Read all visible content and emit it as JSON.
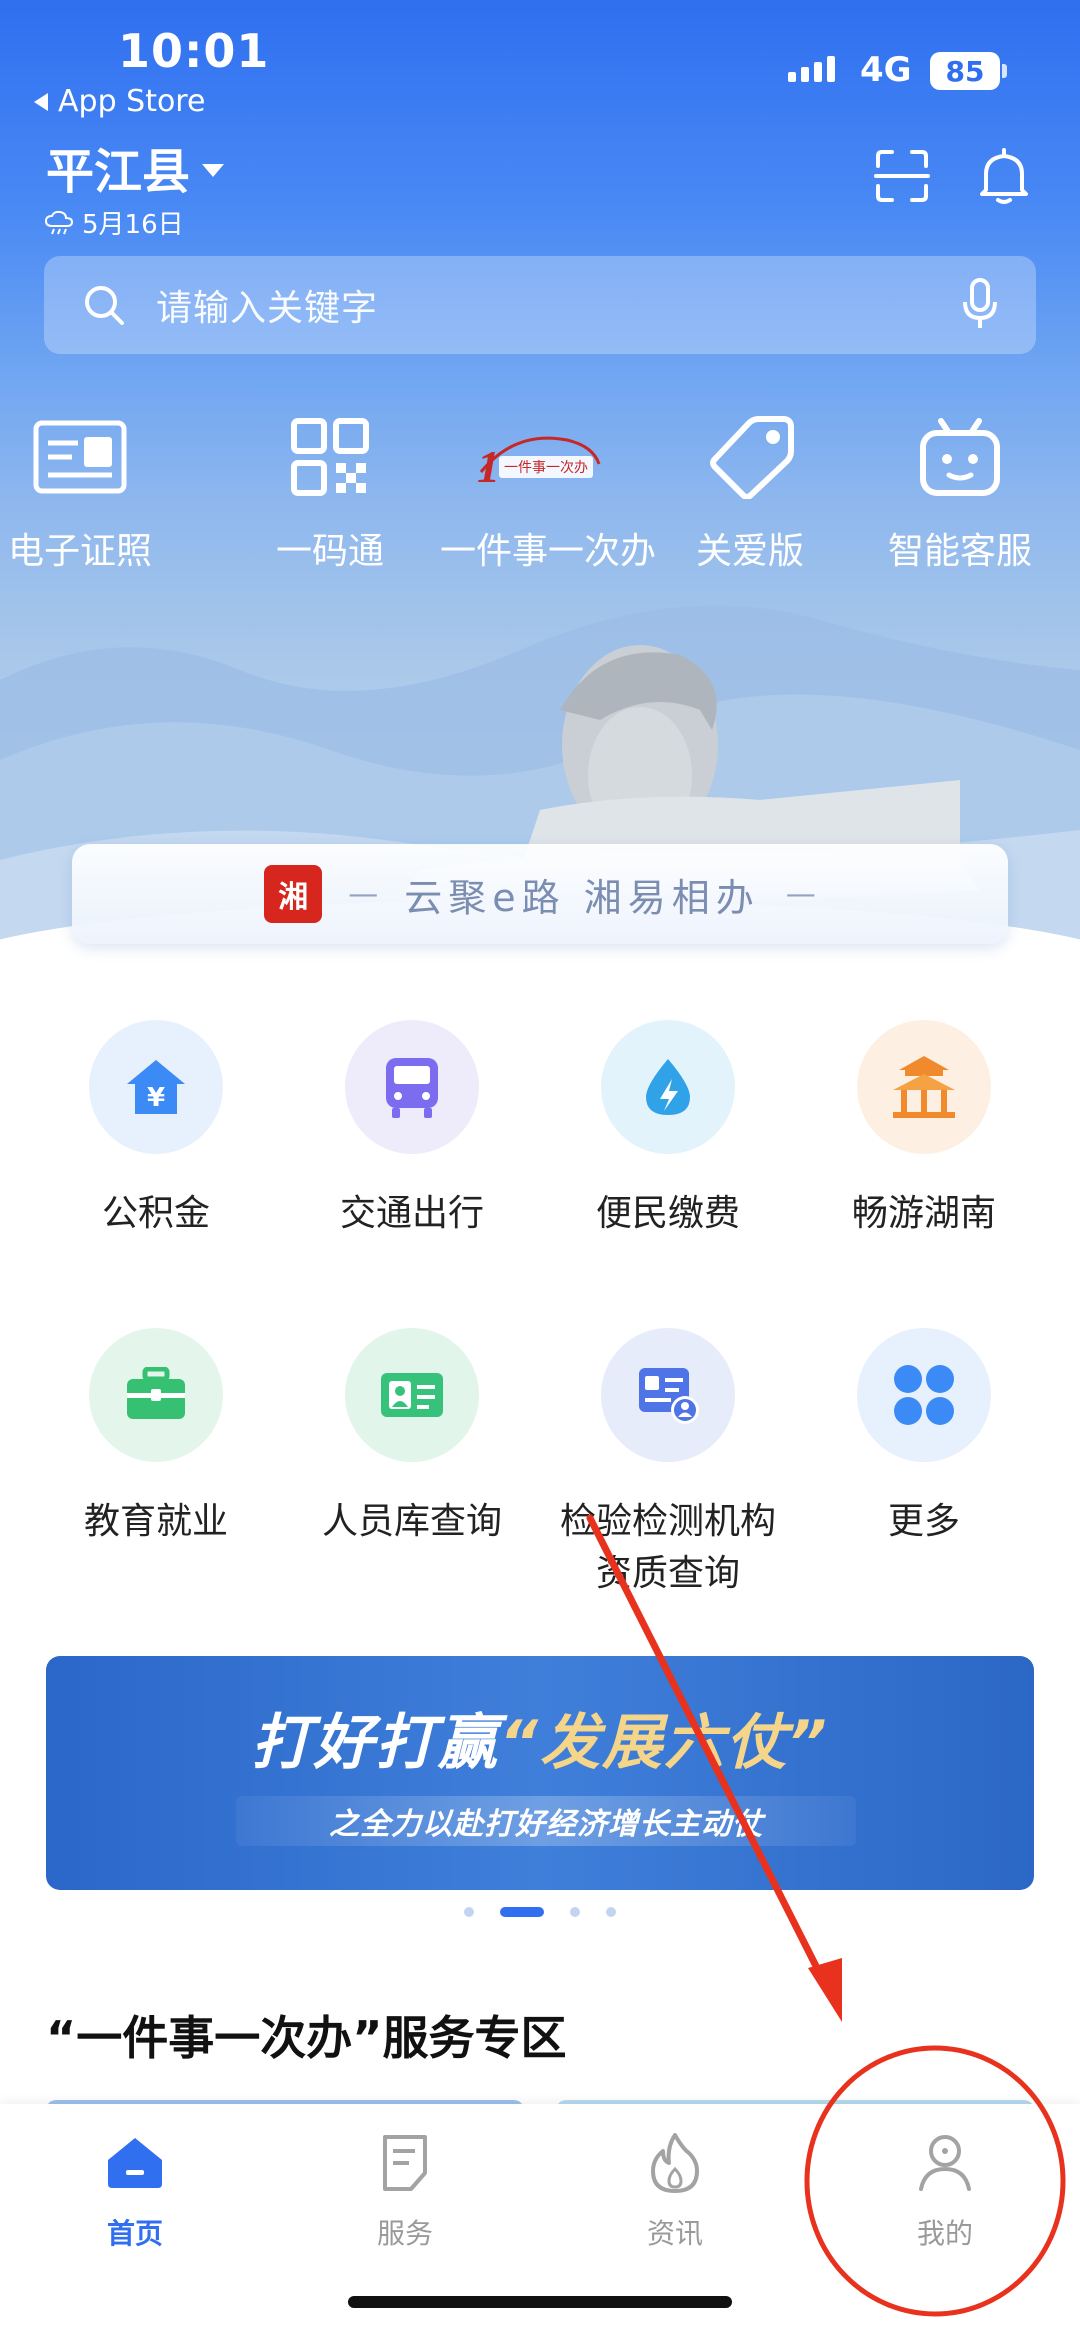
{
  "status_bar": {
    "time": "10:01",
    "back_label": "App Store",
    "network": "4G",
    "battery": "85"
  },
  "header": {
    "location": "平江县",
    "date": "5月16日"
  },
  "search": {
    "placeholder": "请输入关键字"
  },
  "quick_actions": [
    {
      "label": "电子证照",
      "icon": "id-card-icon"
    },
    {
      "label": "一码通",
      "icon": "qr-code-icon"
    },
    {
      "label": "一件事一次办",
      "icon": "one-thing-logo-icon",
      "logo_text": "一件事一次办"
    },
    {
      "label": "关爱版",
      "icon": "care-tag-icon"
    },
    {
      "label": "智能客服",
      "icon": "robot-icon"
    }
  ],
  "slogan": {
    "seal_text": "湘",
    "text": "云聚e路 湘易相办",
    "dash": "—"
  },
  "services": [
    {
      "label": "公积金",
      "icon": "housing-fund-icon"
    },
    {
      "label": "交通出行",
      "icon": "bus-icon"
    },
    {
      "label": "便民缴费",
      "icon": "utility-drop-icon"
    },
    {
      "label": "畅游湖南",
      "icon": "pavilion-icon"
    },
    {
      "label": "教育就业",
      "icon": "briefcase-icon"
    },
    {
      "label": "人员库查询",
      "icon": "person-card-icon"
    },
    {
      "label": "检验检测机构",
      "label2": "资质查询",
      "icon": "certificate-icon"
    },
    {
      "label": "更多",
      "icon": "more-grid-icon"
    }
  ],
  "banner": {
    "title_plain": "打好打赢",
    "title_quote": "“发展六仗”",
    "subtitle": "之全力以赴打好经济增长主动仗"
  },
  "section": {
    "title": "“一件事一次办”服务专区"
  },
  "tabs": [
    {
      "label": "首页",
      "icon": "home-icon",
      "active": true
    },
    {
      "label": "服务",
      "icon": "service-doc-icon",
      "active": false
    },
    {
      "label": "资讯",
      "icon": "flame-icon",
      "active": false
    },
    {
      "label": "我的",
      "icon": "profile-icon",
      "active": false
    }
  ],
  "colors": {
    "primary": "#2f6ff0",
    "annotation": "#e8321e",
    "banner": "#2b67c9"
  }
}
